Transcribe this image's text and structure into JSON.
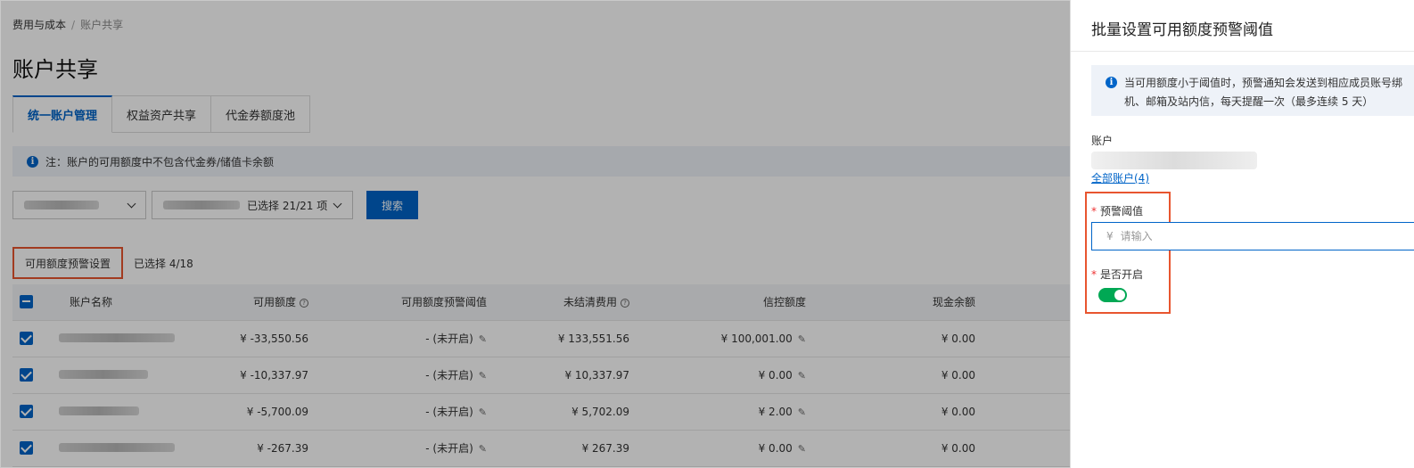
{
  "breadcrumb": {
    "parent": "费用与成本",
    "current": "账户共享"
  },
  "page_title": "账户共享",
  "tabs": [
    {
      "label": "统一账户管理",
      "active": true
    },
    {
      "label": "权益资产共享",
      "active": false
    },
    {
      "label": "代金券额度池",
      "active": false
    }
  ],
  "notice": "注：账户的可用额度中不包含代金券/储值卡余额",
  "filter": {
    "selected_text": "已选择 21/21 项",
    "search_label": "搜索"
  },
  "actions": {
    "threshold_button": "可用额度预警设置",
    "selected_count": "已选择 4/18"
  },
  "table": {
    "headers": {
      "name": "账户名称",
      "available": "可用额度",
      "threshold": "可用额度预警阈值",
      "unsettled": "未结清费用",
      "credit": "信控额度",
      "cash": "现金余额"
    },
    "rows": [
      {
        "available": "¥ -33,550.56",
        "threshold": "- (未开启)",
        "unsettled": "¥ 133,551.56",
        "credit": "¥ 100,001.00",
        "cash": "¥ 0.00"
      },
      {
        "available": "¥ -10,337.97",
        "threshold": "- (未开启)",
        "unsettled": "¥ 10,337.97",
        "credit": "¥ 0.00",
        "cash": "¥ 0.00"
      },
      {
        "available": "¥ -5,700.09",
        "threshold": "- (未开启)",
        "unsettled": "¥ 5,702.09",
        "credit": "¥ 2.00",
        "cash": "¥ 0.00"
      },
      {
        "available": "¥ -267.39",
        "threshold": "- (未开启)",
        "unsettled": "¥ 267.39",
        "credit": "¥ 0.00",
        "cash": "¥ 0.00"
      }
    ]
  },
  "drawer": {
    "title": "批量设置可用额度预警阈值",
    "notice_line1": "当可用额度小于阈值时，预警通知会发送到相应成员账号绑",
    "notice_line2": "机、邮箱及站内信，每天提醒一次（最多连续 5 天）",
    "account_label": "账户",
    "all_accounts_link": "全部账户(4)",
    "threshold_label": "预警阈值",
    "currency_symbol": "¥",
    "threshold_placeholder": "请输入",
    "enable_label": "是否开启",
    "enabled": true
  },
  "colors": {
    "primary": "#0064c8",
    "highlight": "#e8552f",
    "toggle_on": "#00a854"
  }
}
